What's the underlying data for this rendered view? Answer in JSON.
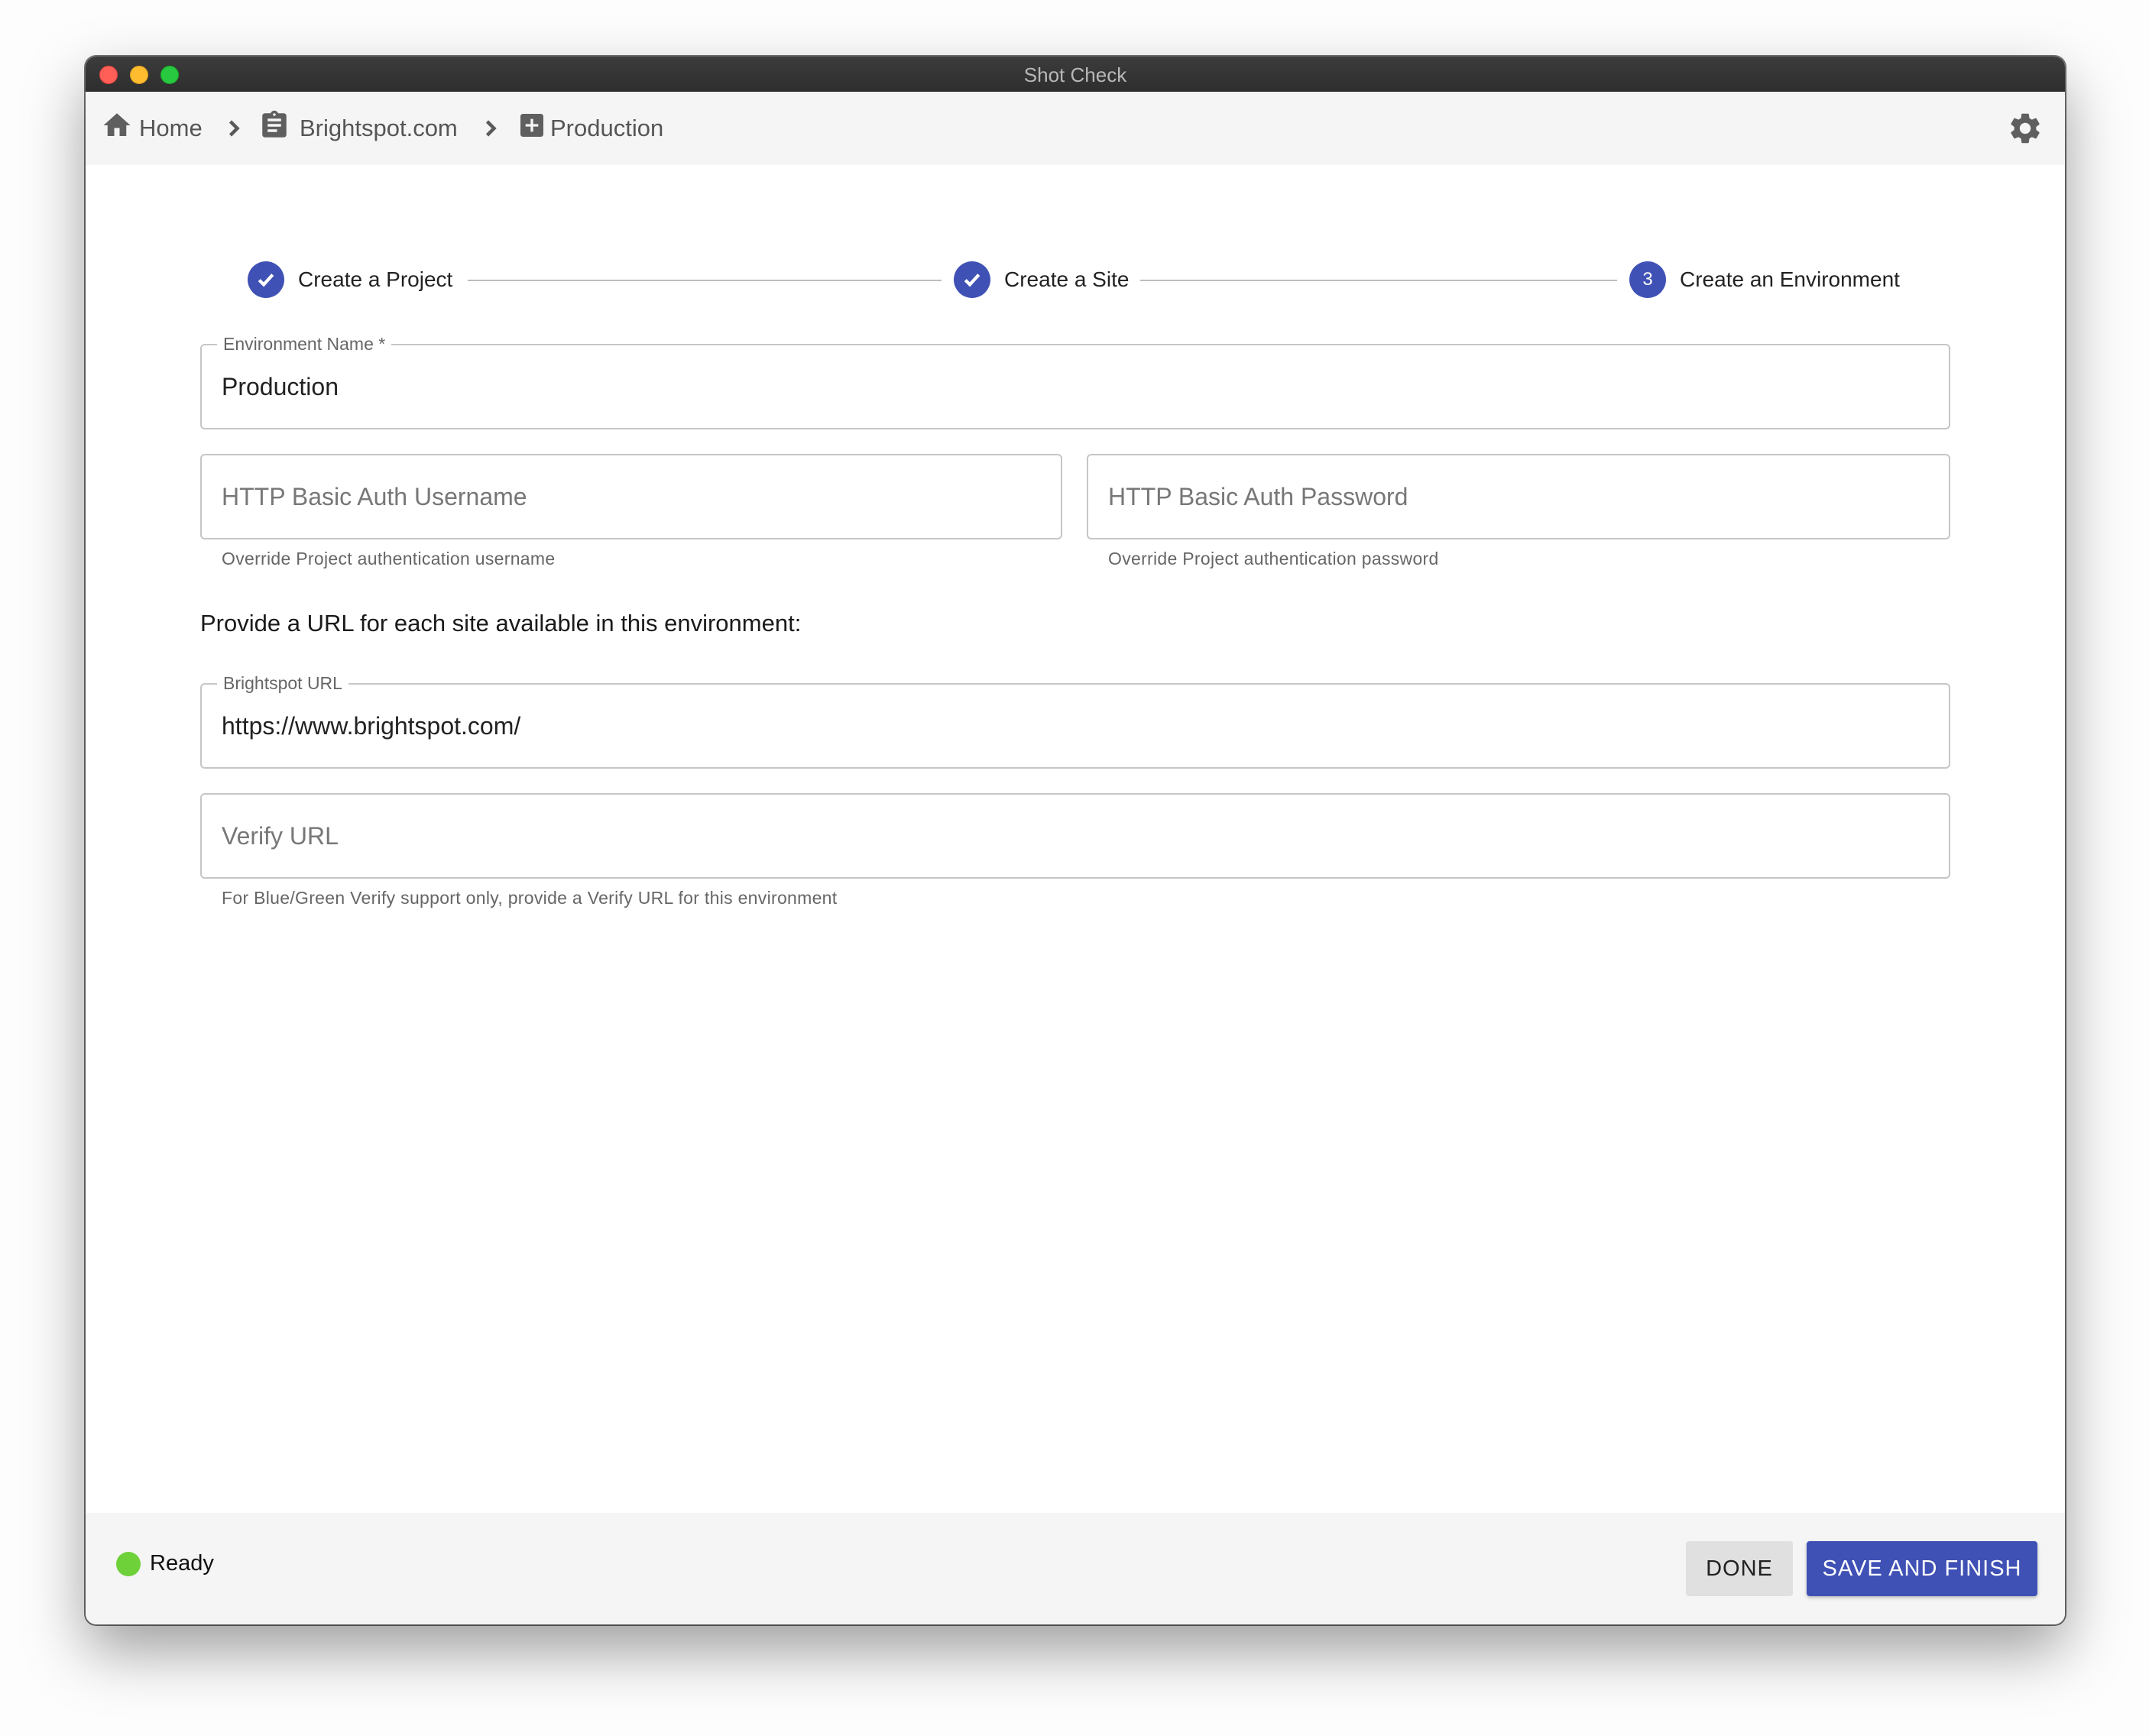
{
  "window": {
    "title": "Shot Check"
  },
  "breadcrumb": {
    "home": {
      "label": "Home",
      "icon": "home-icon"
    },
    "project": {
      "label": "Brightspot.com",
      "icon": "clipboard-icon"
    },
    "current": {
      "label": "Production",
      "icon": "add-box-icon"
    }
  },
  "settings": {
    "icon": "gear-icon"
  },
  "stepper": {
    "steps": [
      {
        "label": "Create a Project",
        "state": "completed"
      },
      {
        "label": "Create a Site",
        "state": "completed"
      },
      {
        "label": "Create an Environment",
        "state": "active",
        "number": "3"
      }
    ]
  },
  "form": {
    "environment_name": {
      "label": "Environment Name *",
      "value": "Production"
    },
    "auth_username": {
      "placeholder": "HTTP Basic Auth Username",
      "helper": "Override Project authentication username"
    },
    "auth_password": {
      "placeholder": "HTTP Basic Auth Password",
      "helper": "Override Project authentication password"
    },
    "urls_prompt": "Provide a URL for each site available in this environment:",
    "brightspot_url": {
      "label": "Brightspot URL",
      "value": "https://www.brightspot.com/"
    },
    "verify_url": {
      "placeholder": "Verify URL",
      "helper": "For Blue/Green Verify support only, provide a Verify URL for this environment"
    }
  },
  "footer": {
    "status": "Ready",
    "status_color": "#6fd13a",
    "done_label": "DONE",
    "save_label": "SAVE AND FINISH"
  },
  "colors": {
    "primary": "#3f51b5"
  }
}
